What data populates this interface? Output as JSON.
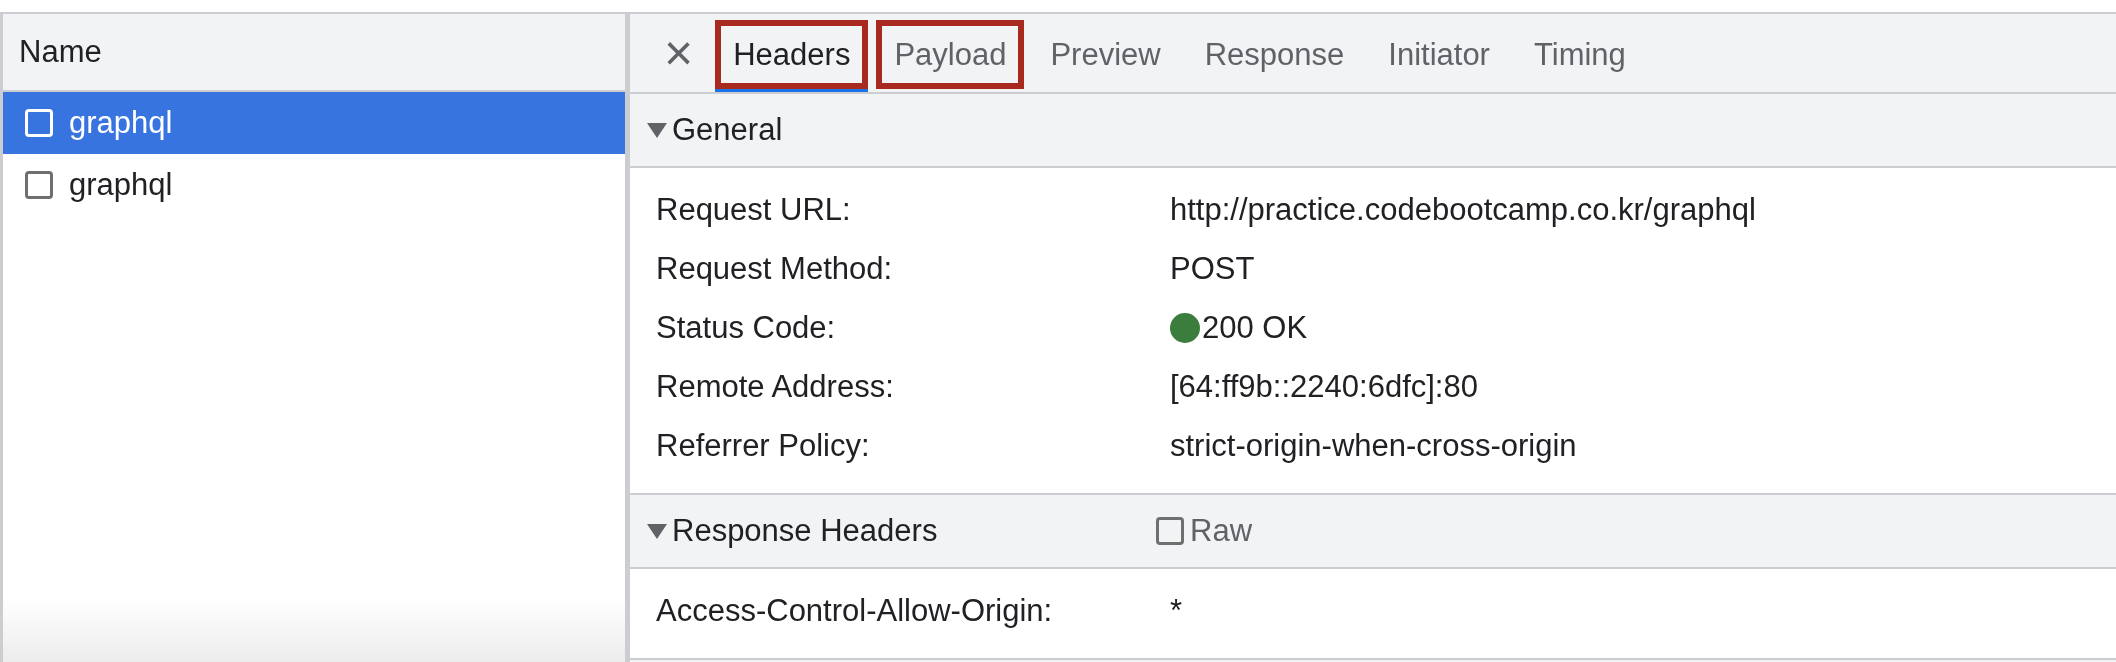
{
  "request_list": {
    "column_header": "Name",
    "rows": [
      {
        "name": "graphql",
        "selected": true,
        "checked": false
      },
      {
        "name": "graphql",
        "selected": false,
        "checked": false
      }
    ]
  },
  "details": {
    "close": "×",
    "tabs": [
      {
        "label": "Headers",
        "selected": true,
        "highlighted": true
      },
      {
        "label": "Payload",
        "selected": false,
        "highlighted": true
      },
      {
        "label": "Preview",
        "selected": false,
        "highlighted": false
      },
      {
        "label": "Response",
        "selected": false,
        "highlighted": false
      },
      {
        "label": "Initiator",
        "selected": false,
        "highlighted": false
      },
      {
        "label": "Timing",
        "selected": false,
        "highlighted": false
      }
    ],
    "sections": [
      {
        "title": "General",
        "expanded": true,
        "rows": [
          {
            "key": "Request URL:",
            "value": "http://practice.codebootcamp.co.kr/graphql"
          },
          {
            "key": "Request Method:",
            "value": "POST"
          },
          {
            "key": "Status Code:",
            "value": "200 OK",
            "color": "#3a7d3c"
          },
          {
            "key": "Remote Address:",
            "value": "[64:ff9b::2240:6dfc]:80"
          },
          {
            "key": "Referrer Policy:",
            "value": "strict-origin-when-cross-origin"
          }
        ]
      },
      {
        "title": "Response Headers",
        "expanded": true,
        "raw": {
          "label": "Raw",
          "checked": false
        },
        "rows": [
          {
            "key": "Access-Control-Allow-Origin:",
            "value": "*"
          }
        ]
      }
    ]
  }
}
